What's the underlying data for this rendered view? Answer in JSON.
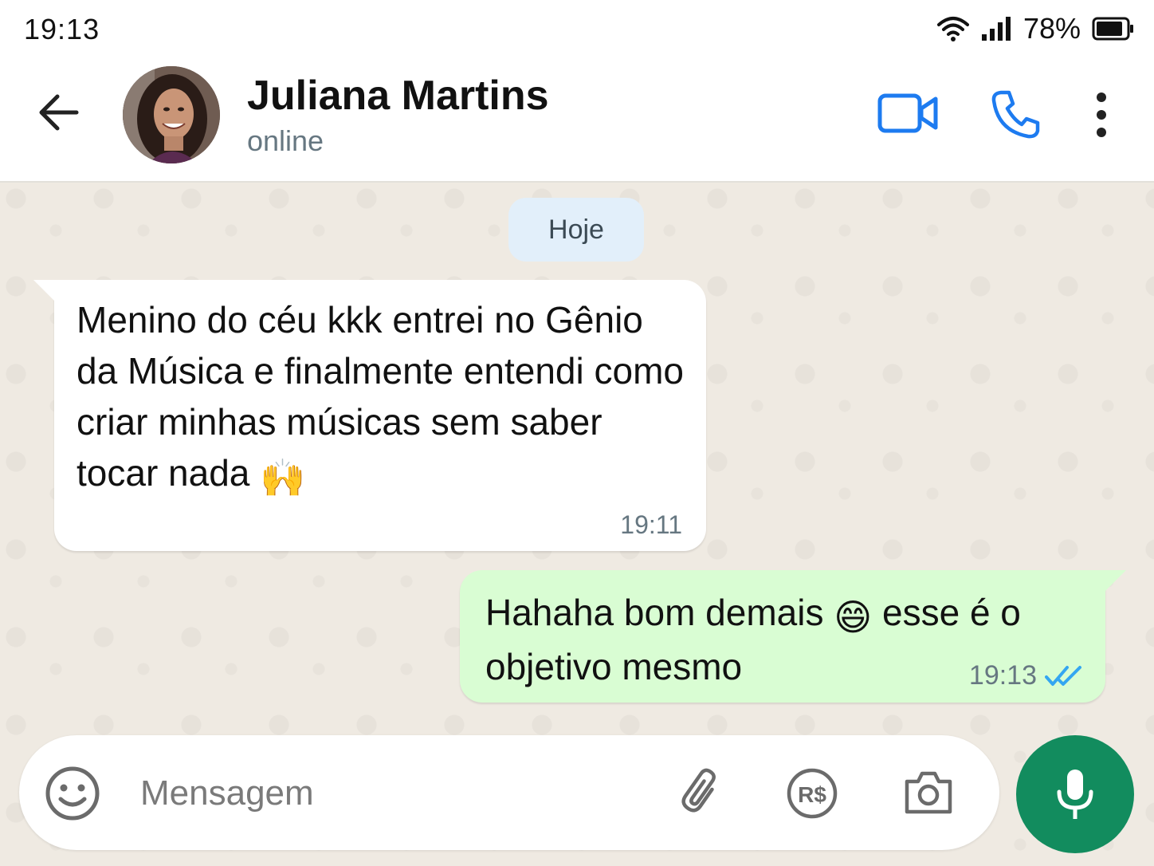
{
  "status_bar": {
    "time": "19:13",
    "battery_percent": "78%",
    "wifi_icon": "wifi-icon",
    "signal_icon": "signal-icon",
    "battery_icon": "battery-icon"
  },
  "header": {
    "contact_name": "Juliana Martins",
    "contact_status": "online",
    "back_icon": "arrow-left-icon",
    "video_icon": "video-camera-icon",
    "call_icon": "phone-icon",
    "menu_icon": "more-vertical-icon"
  },
  "chat": {
    "date_label": "Hoje",
    "messages": [
      {
        "direction": "incoming",
        "text": "Menino do céu kkk entrei no Gênio da Música e finalmente entendi como criar minhas músicas sem saber tocar nada",
        "emoji": "🙌",
        "time": "19:11"
      },
      {
        "direction": "outgoing",
        "text_before_emoji": "Hahaha bom demais",
        "emoji": "😄",
        "text_after_emoji": "esse é o objetivo mesmo",
        "time": "19:13",
        "read_icon": "double-check-icon"
      }
    ]
  },
  "input_bar": {
    "placeholder": "Mensagem",
    "emoji_icon": "smiley-icon",
    "attach_icon": "paperclip-icon",
    "payment_icon": "real-payment-icon",
    "payment_label": "R$",
    "camera_icon": "camera-icon",
    "mic_icon": "microphone-icon"
  },
  "colors": {
    "accent_blue": "#1d7bf0",
    "mic_green": "#128c5e",
    "outgoing_bubble": "#d9fdd3",
    "date_chip": "#e2effa",
    "read_check": "#34a6f1"
  }
}
